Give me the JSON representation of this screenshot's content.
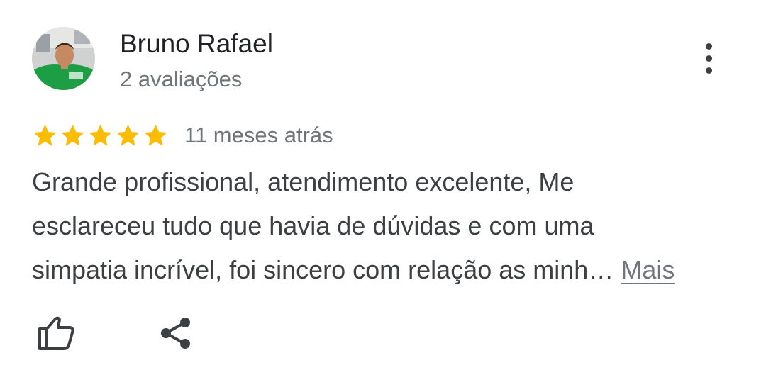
{
  "author": {
    "name": "Bruno Rafael",
    "review_count": "2 avaliações",
    "avatar_icon": "user-avatar-photo"
  },
  "review": {
    "rating": 5,
    "rating_max": 5,
    "star_color": "#fbbc04",
    "date": "11 meses atrás",
    "text_lines": [
      "Grande profissional, atendimento excelente, Me",
      "esclareceu tudo que havia de dúvidas e com uma",
      "simpatia incrível, foi sincero com relação as minh…"
    ],
    "more_label": "Mais"
  },
  "actions": {
    "like_icon": "thumbs-up-icon",
    "share_icon": "share-icon",
    "more_icon": "more-vert-icon"
  }
}
